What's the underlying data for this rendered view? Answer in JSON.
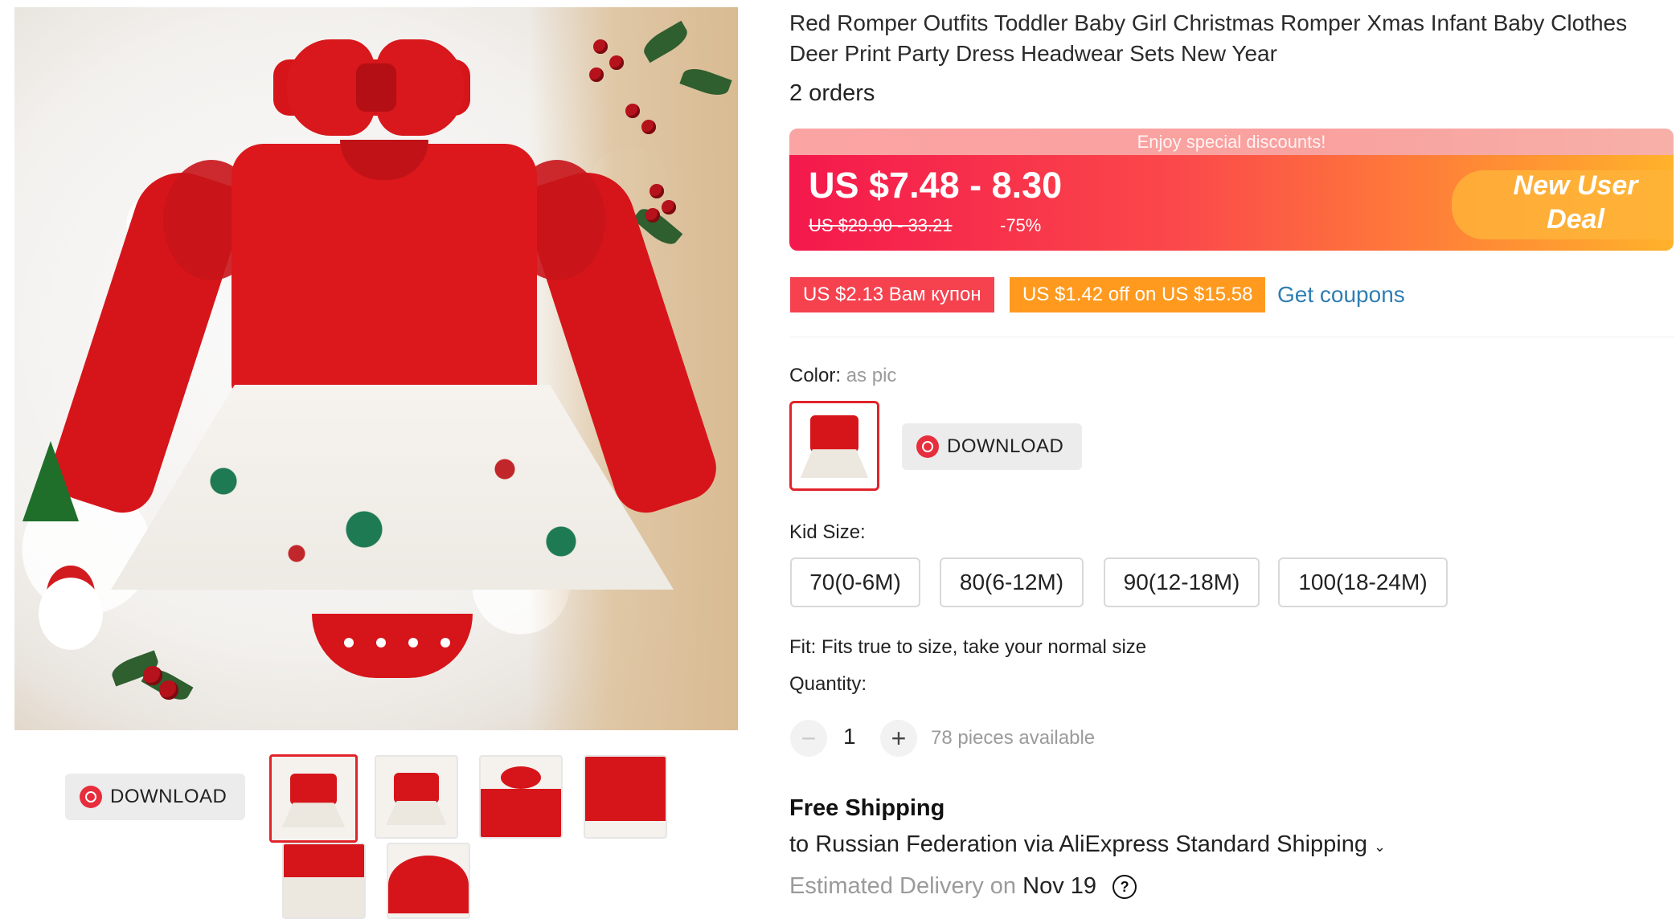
{
  "product": {
    "title": "Red Romper Outfits Toddler Baby Girl Christmas Romper Xmas Infant Baby Clothes Deer Print Party Dress Headwear Sets New Year",
    "orders": "2 orders"
  },
  "gallery": {
    "download_label": "DOWNLOAD",
    "thumbnails": [
      "thumb-1",
      "thumb-2",
      "thumb-3",
      "thumb-4",
      "thumb-5",
      "thumb-6"
    ]
  },
  "promo": {
    "banner": "Enjoy special discounts!",
    "price": "US $7.48 - 8.30",
    "original_price": "US $29.90 - 33.21",
    "discount": "-75%",
    "badge_line1": "New User",
    "badge_line2": "Deal"
  },
  "coupons": {
    "coupon1": "US $2.13 Вам купон",
    "coupon2": "US $1.42 off on US $15.58",
    "get_coupons": "Get coupons"
  },
  "color": {
    "label": "Color:",
    "value": "as pic",
    "download_label": "DOWNLOAD"
  },
  "size": {
    "label": "Kid Size:",
    "options": [
      "70(0-6M)",
      "80(6-12M)",
      "90(12-18M)",
      "100(18-24M)"
    ]
  },
  "fit": "Fit: Fits true to size, take your normal size",
  "quantity": {
    "label": "Quantity:",
    "minus": "−",
    "value": "1",
    "plus": "+",
    "available": "78 pieces available"
  },
  "shipping": {
    "title": "Free Shipping",
    "to": "to Russian Federation via AliExpress Standard Shipping",
    "chevron": "⌄",
    "estimated_label": "Estimated Delivery on",
    "estimated_date": "Nov 19",
    "help": "?"
  },
  "colors": {
    "accent_red": "#e0242a",
    "link_blue": "#2f7eb4"
  }
}
